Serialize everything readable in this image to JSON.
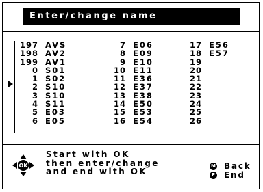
{
  "title": "Enter/change name",
  "columns": [
    {
      "rows": [
        {
          "num": "197",
          "name": "AVS"
        },
        {
          "num": "198",
          "name": "AV2"
        },
        {
          "num": "199",
          "name": "AV1"
        },
        {
          "num": "0",
          "name": "S01"
        },
        {
          "num": "1",
          "name": "S02"
        },
        {
          "num": "2",
          "name": "S10"
        },
        {
          "num": "3",
          "name": "S10"
        },
        {
          "num": "4",
          "name": "S11"
        },
        {
          "num": "5",
          "name": "E03"
        },
        {
          "num": "6",
          "name": "E05"
        }
      ]
    },
    {
      "rows": [
        {
          "num": "7",
          "name": "E06"
        },
        {
          "num": "8",
          "name": "E09"
        },
        {
          "num": "9",
          "name": "E10"
        },
        {
          "num": "10",
          "name": "E11"
        },
        {
          "num": "11",
          "name": "E36"
        },
        {
          "num": "12",
          "name": "E37"
        },
        {
          "num": "13",
          "name": "E38"
        },
        {
          "num": "14",
          "name": "E50"
        },
        {
          "num": "15",
          "name": "E53"
        },
        {
          "num": "16",
          "name": "E54"
        }
      ]
    },
    {
      "rows": [
        {
          "num": "17",
          "name": "E56"
        },
        {
          "num": "18",
          "name": "E57"
        },
        {
          "num": "19",
          "name": ""
        },
        {
          "num": "20",
          "name": ""
        },
        {
          "num": "21",
          "name": ""
        },
        {
          "num": "22",
          "name": ""
        },
        {
          "num": "23",
          "name": ""
        },
        {
          "num": "24",
          "name": ""
        },
        {
          "num": "25",
          "name": ""
        },
        {
          "num": "26",
          "name": ""
        }
      ]
    }
  ],
  "selected_index": 4,
  "help": {
    "ok_badge": "OK",
    "line1": "Start with OK",
    "line2": "then enter/change",
    "line3": "and end with OK"
  },
  "legend": {
    "back_key": "M",
    "back_label": "Back",
    "end_key": "E",
    "end_label": "End"
  },
  "icons": {
    "joystick": "ok-joystick-icon",
    "pointer": "selection-pointer-icon",
    "back": "m-button-icon",
    "end": "e-button-icon"
  }
}
